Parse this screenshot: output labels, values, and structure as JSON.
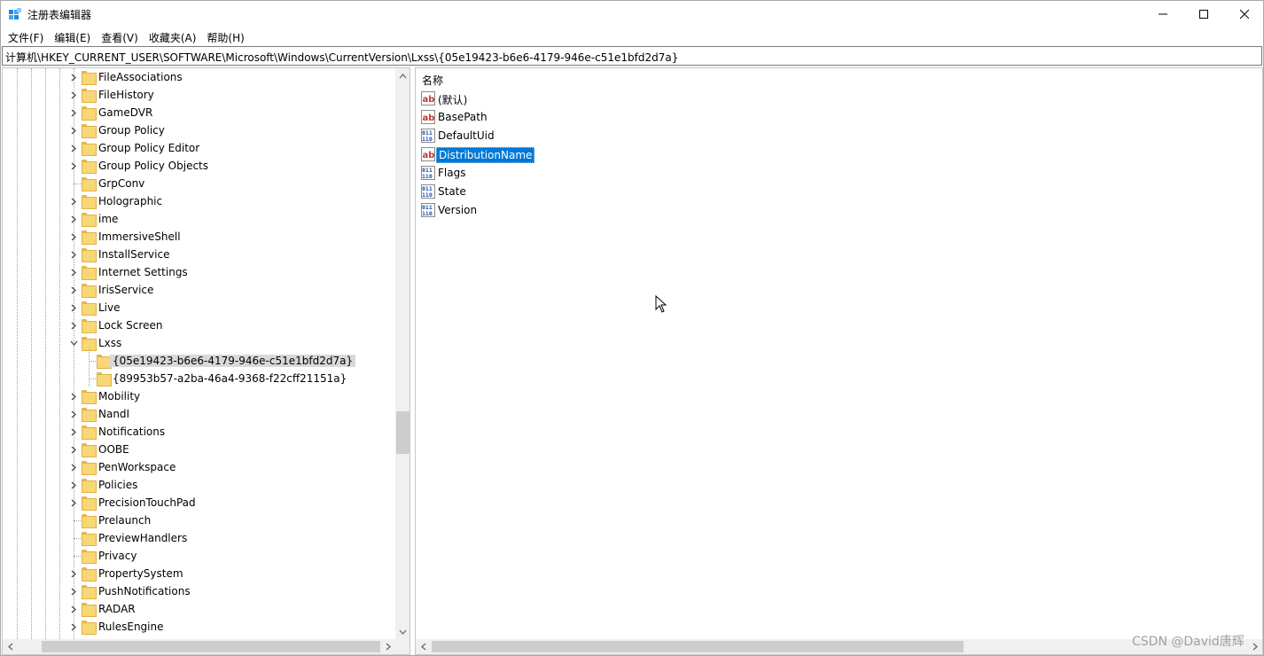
{
  "window": {
    "title": "注册表编辑器"
  },
  "menu": [
    "文件(F)",
    "编辑(E)",
    "查看(V)",
    "收藏夹(A)",
    "帮助(H)"
  ],
  "address": "计算机\\HKEY_CURRENT_USER\\SOFTWARE\\Microsoft\\Windows\\CurrentVersion\\Lxss\\{05e19423-b6e6-4179-946e-c51e1bfd2d7a}",
  "tree": {
    "items": [
      {
        "label": "FileAssociations",
        "expandable": true
      },
      {
        "label": "FileHistory",
        "expandable": true
      },
      {
        "label": "GameDVR",
        "expandable": true
      },
      {
        "label": "Group Policy",
        "expandable": true
      },
      {
        "label": "Group Policy Editor",
        "expandable": true
      },
      {
        "label": "Group Policy Objects",
        "expandable": true
      },
      {
        "label": "GrpConv",
        "expandable": false
      },
      {
        "label": "Holographic",
        "expandable": true
      },
      {
        "label": "ime",
        "expandable": true
      },
      {
        "label": "ImmersiveShell",
        "expandable": true
      },
      {
        "label": "InstallService",
        "expandable": true
      },
      {
        "label": "Internet Settings",
        "expandable": true
      },
      {
        "label": "IrisService",
        "expandable": true
      },
      {
        "label": "Live",
        "expandable": true
      },
      {
        "label": "Lock Screen",
        "expandable": true
      },
      {
        "label": "Lxss",
        "expandable": true,
        "expanded": true
      },
      {
        "label": "{05e19423-b6e6-4179-946e-c51e1bfd2d7a}",
        "child": true,
        "selected": true
      },
      {
        "label": "{89953b57-a2ba-46a4-9368-f22cff21151a}",
        "child": true
      },
      {
        "label": "Mobility",
        "expandable": true
      },
      {
        "label": "NandI",
        "expandable": true
      },
      {
        "label": "Notifications",
        "expandable": true
      },
      {
        "label": "OOBE",
        "expandable": true
      },
      {
        "label": "PenWorkspace",
        "expandable": true
      },
      {
        "label": "Policies",
        "expandable": true
      },
      {
        "label": "PrecisionTouchPad",
        "expandable": true
      },
      {
        "label": "Prelaunch",
        "expandable": false
      },
      {
        "label": "PreviewHandlers",
        "expandable": false
      },
      {
        "label": "Privacy",
        "expandable": false
      },
      {
        "label": "PropertySystem",
        "expandable": true
      },
      {
        "label": "PushNotifications",
        "expandable": true
      },
      {
        "label": "RADAR",
        "expandable": true
      },
      {
        "label": "RulesEngine",
        "expandable": true
      }
    ]
  },
  "values": {
    "column_header": "名称",
    "items": [
      {
        "name": "(默认)",
        "type": "string-value-icon"
      },
      {
        "name": "BasePath",
        "type": "string-value-icon"
      },
      {
        "name": "DefaultUid",
        "type": "binary-value-icon"
      },
      {
        "name": "DistributionName",
        "type": "string-value-icon",
        "selected": true
      },
      {
        "name": "Flags",
        "type": "binary-value-icon"
      },
      {
        "name": "State",
        "type": "binary-value-icon"
      },
      {
        "name": "Version",
        "type": "binary-value-icon"
      }
    ]
  },
  "watermark": "CSDN @David唐辉"
}
